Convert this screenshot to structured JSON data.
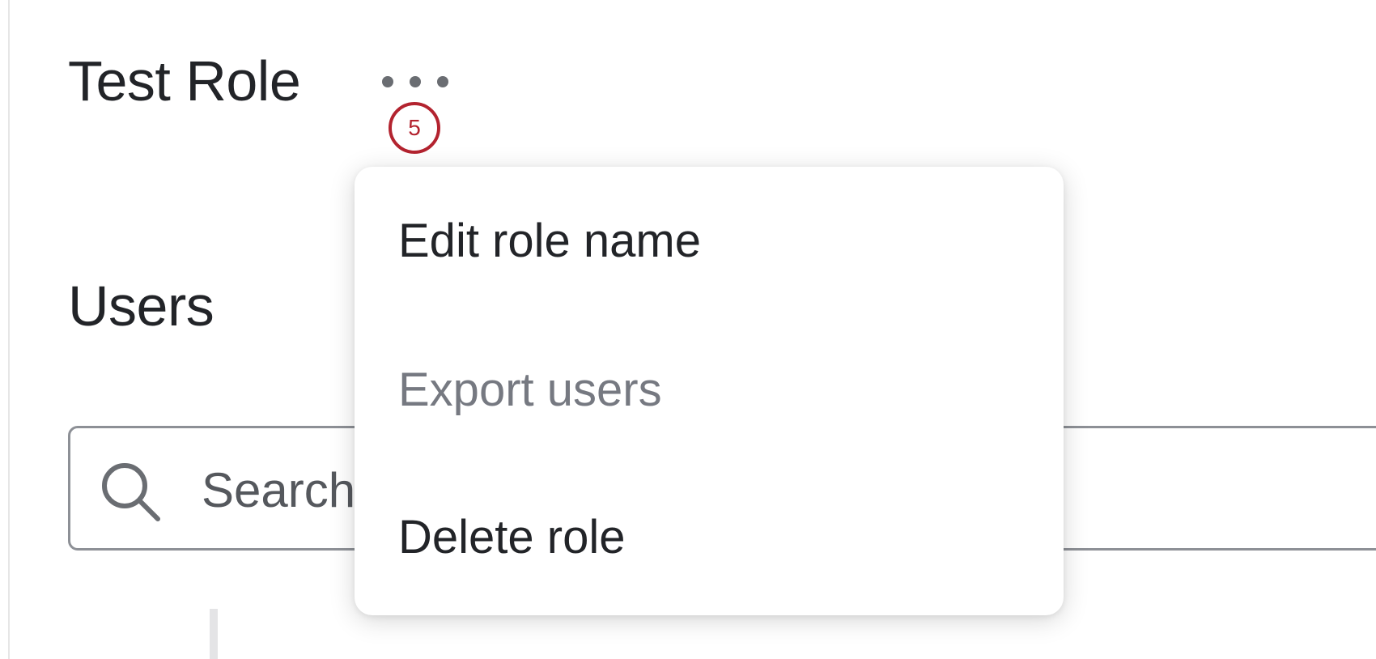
{
  "header": {
    "title": "Test Role",
    "more_icon": "more-horizontal-icon",
    "step_badge": "5"
  },
  "users_section": {
    "heading": "Users",
    "search": {
      "icon": "search-icon",
      "placeholder": "Search"
    }
  },
  "menu": {
    "items": [
      {
        "label": "Edit role name",
        "enabled": true
      },
      {
        "label": "Export users",
        "enabled": false
      },
      {
        "label": "Delete role",
        "enabled": true
      }
    ]
  },
  "colors": {
    "text": "#222428",
    "disabled_text": "#767981",
    "badge": "#b3232f",
    "border": "#8d9096",
    "icon": "#6a6d72"
  }
}
